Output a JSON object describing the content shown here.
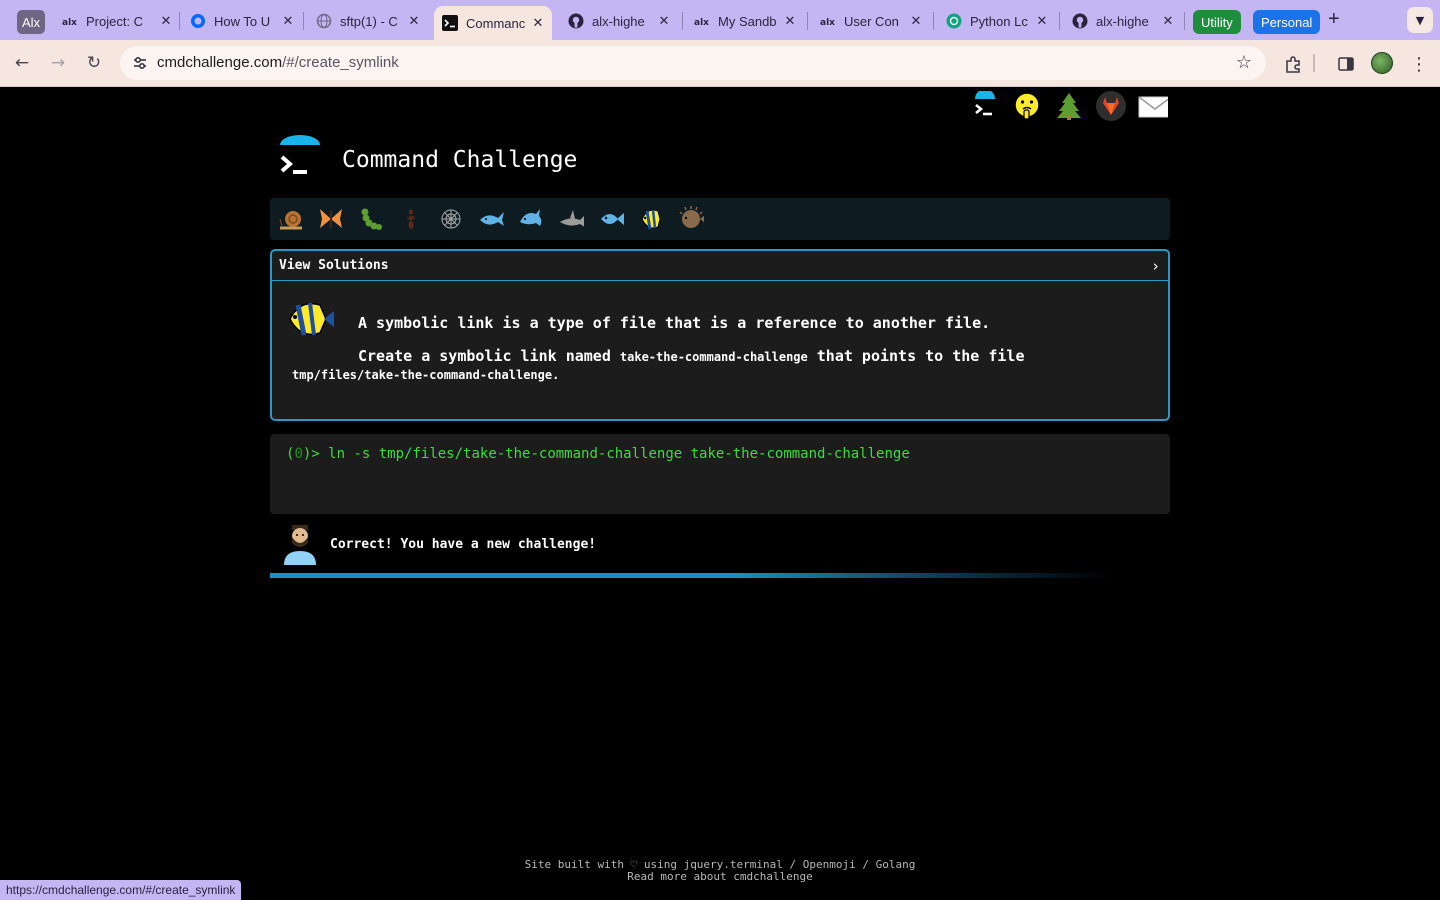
{
  "browser": {
    "profile_chip": "Alx",
    "tabs": [
      {
        "label": "Project: C",
        "icon": "alx-icon"
      },
      {
        "label": "How To U",
        "icon": "digitalocean-icon"
      },
      {
        "label": "sftp(1) - C",
        "icon": "globe-icon"
      },
      {
        "label": "Commanc",
        "icon": "terminal-icon",
        "active": true
      },
      {
        "label": "alx-highe",
        "icon": "github-icon"
      },
      {
        "label": "My Sandb",
        "icon": "alx-icon"
      },
      {
        "label": "User Con",
        "icon": "alx-icon"
      },
      {
        "label": "Python Lc",
        "icon": "chatgpt-icon"
      },
      {
        "label": "alx-highe",
        "icon": "github-icon"
      }
    ],
    "groups": {
      "utility": {
        "label": "Utility",
        "color": "#1e8e3e"
      },
      "personal": {
        "label": "Personal",
        "color": "#1a73e8"
      }
    },
    "url_host": "cmdchallenge.com",
    "url_path": "/#/create_symlink",
    "status_url": "https://cmdchallenge.com/#/create_symlink"
  },
  "site": {
    "title": "Command Challenge",
    "header_icons": [
      "terminal-icon",
      "hint-face-icon",
      "tree-icon",
      "gitlab-icon",
      "mail-icon"
    ],
    "emoji_bar": [
      "snail-icon",
      "butterfly-icon",
      "caterpillar-icon",
      "ant-icon",
      "spider-web-icon",
      "whale-icon",
      "dolphin-icon",
      "shark-icon",
      "fish-icon",
      "tropical-fish-icon",
      "blowfish-icon"
    ],
    "challenge": {
      "view_solutions": "View Solutions",
      "chevron": "›",
      "line1": "A symbolic link is a type of file that is a reference to another file.",
      "line2_prefix": "Create a symbolic link named ",
      "link_name": "take-the-command-challenge",
      "line2_suffix": " that points to the file",
      "target_path": "tmp/files/take-the-command-challenge",
      "period": "."
    },
    "terminal": {
      "prompt_open": "(",
      "exit_code": "0",
      "prompt_close": ")> ",
      "command": "ln -s tmp/files/take-the-command-challenge take-the-command-challenge"
    },
    "result": {
      "message": "Correct! You have a new challenge!",
      "progress": 0.58
    },
    "footer": {
      "line1": "Site built with ♡ using jquery.terminal / Openmoji / Golang",
      "line2": "Read more about cmdchallenge"
    }
  },
  "colors": {
    "accent": "#2a97c7",
    "terminal_green": "#3ddc3d",
    "tabbar": "#c3b6f2"
  }
}
